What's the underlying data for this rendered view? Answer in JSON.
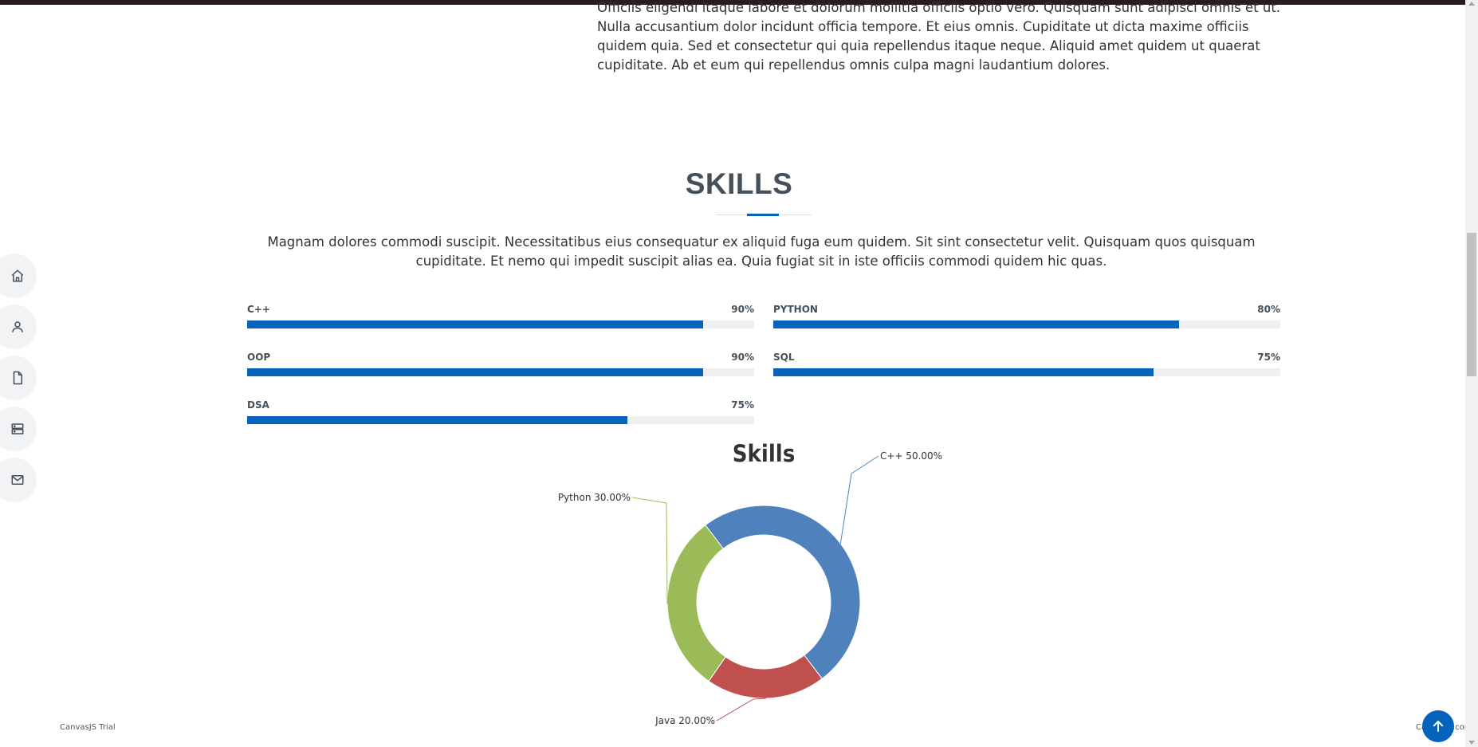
{
  "about": {
    "text": "Officiis eligendi itaque labore et dolorum mollitia officiis optio vero. Quisquam sunt adipisci omnis et ut. Nulla accusantium dolor incidunt officia tempore. Et eius omnis. Cupiditate ut dicta maxime officiis quidem quia. Sed et consectetur qui quia repellendus itaque neque. Aliquid amet quidem ut quaerat cupiditate. Ab et eum qui repellendus omnis culpa magni laudantium dolores."
  },
  "skills_section": {
    "title": "SKILLS",
    "description": "Magnam dolores commodi suscipit. Necessitatibus eius consequatur ex aliquid fuga eum quidem. Sit sint consectetur velit. Quisquam quos quisquam cupiditate. Et nemo qui impedit suscipit alias ea. Quia fugiat sit in iste officiis commodi quidem hic quas.",
    "items": [
      {
        "name": "C++",
        "value_label": "90%",
        "percent": 90
      },
      {
        "name": "PYTHON",
        "value_label": "80%",
        "percent": 80
      },
      {
        "name": "OOP",
        "value_label": "90%",
        "percent": 90
      },
      {
        "name": "SQL",
        "value_label": "75%",
        "percent": 75
      },
      {
        "name": "DSA",
        "value_label": "75%",
        "percent": 75
      }
    ]
  },
  "side_nav": {
    "items": [
      {
        "icon": "home-icon"
      },
      {
        "icon": "person-icon"
      },
      {
        "icon": "file-icon"
      },
      {
        "icon": "server-icon"
      },
      {
        "icon": "envelope-icon"
      }
    ]
  },
  "chart_data": {
    "type": "pie",
    "variant": "doughnut",
    "title": "Skills",
    "slices": [
      {
        "label": "C++",
        "value": 50,
        "index_label": "C++ 50.00%",
        "color": "#4f81bc"
      },
      {
        "label": "Java",
        "value": 20,
        "index_label": "Java 20.00%",
        "color": "#c0504e"
      },
      {
        "label": "Python",
        "value": 30,
        "index_label": "Python 30.00%",
        "color": "#9bbb58"
      }
    ]
  },
  "watermark": {
    "left": "CanvasJS Trial",
    "right": "CanvasJS.com"
  },
  "colors": {
    "accent": "#0563bb",
    "track": "#efefef",
    "title": "#45505b"
  }
}
